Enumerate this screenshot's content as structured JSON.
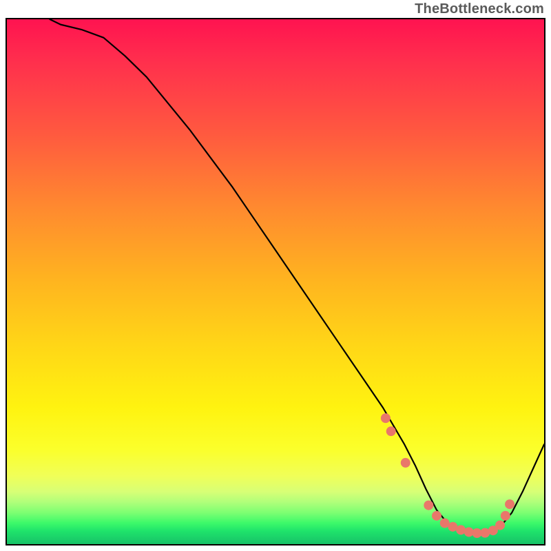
{
  "attribution": "TheBottleneck.com",
  "chart_data": {
    "type": "line",
    "title": "",
    "xlabel": "",
    "ylabel": "",
    "xlim": [
      0,
      100
    ],
    "ylim": [
      0,
      100
    ],
    "series": [
      {
        "name": "curve",
        "x": [
          8,
          10,
          14,
          18,
          22,
          26,
          30,
          34,
          38,
          42,
          46,
          50,
          54,
          58,
          62,
          66,
          70,
          72,
          74,
          76,
          78,
          80,
          82,
          84,
          86,
          88,
          90,
          92,
          94,
          96,
          98,
          100
        ],
        "y": [
          100,
          99,
          98,
          96.5,
          93,
          89,
          84,
          79,
          73.5,
          68,
          62,
          56,
          50,
          44,
          38,
          32,
          26,
          22.5,
          19,
          15,
          10.5,
          6.5,
          4,
          2.8,
          2.1,
          2,
          2.3,
          3.5,
          6,
          10,
          14.5,
          19
        ]
      }
    ],
    "markers": {
      "name": "dots",
      "color": "#e9776a",
      "x": [
        70.5,
        71.5,
        74.2,
        78.5,
        80,
        81.5,
        83,
        84.5,
        86,
        87.5,
        89,
        90.5,
        91.8,
        92.8,
        93.6
      ],
      "y": [
        24,
        21.5,
        15.5,
        7.4,
        5.4,
        4,
        3.3,
        2.7,
        2.3,
        2.1,
        2.15,
        2.6,
        3.6,
        5.4,
        7.6
      ]
    },
    "gradient_stops": [
      {
        "pos": 0,
        "color": "#ff1350"
      },
      {
        "pos": 0.08,
        "color": "#ff2f4d"
      },
      {
        "pos": 0.22,
        "color": "#ff5a3f"
      },
      {
        "pos": 0.36,
        "color": "#ff8a2f"
      },
      {
        "pos": 0.5,
        "color": "#ffb51f"
      },
      {
        "pos": 0.62,
        "color": "#ffd617"
      },
      {
        "pos": 0.74,
        "color": "#fff310"
      },
      {
        "pos": 0.82,
        "color": "#fbff2b"
      },
      {
        "pos": 0.87,
        "color": "#f0ff58"
      },
      {
        "pos": 0.9,
        "color": "#d8ff76"
      },
      {
        "pos": 0.92,
        "color": "#b0ff7a"
      },
      {
        "pos": 0.94,
        "color": "#7dff72"
      },
      {
        "pos": 0.96,
        "color": "#3cf96a"
      },
      {
        "pos": 0.975,
        "color": "#1fe36b"
      },
      {
        "pos": 0.99,
        "color": "#1acf69"
      },
      {
        "pos": 1.0,
        "color": "#18c267"
      }
    ]
  }
}
